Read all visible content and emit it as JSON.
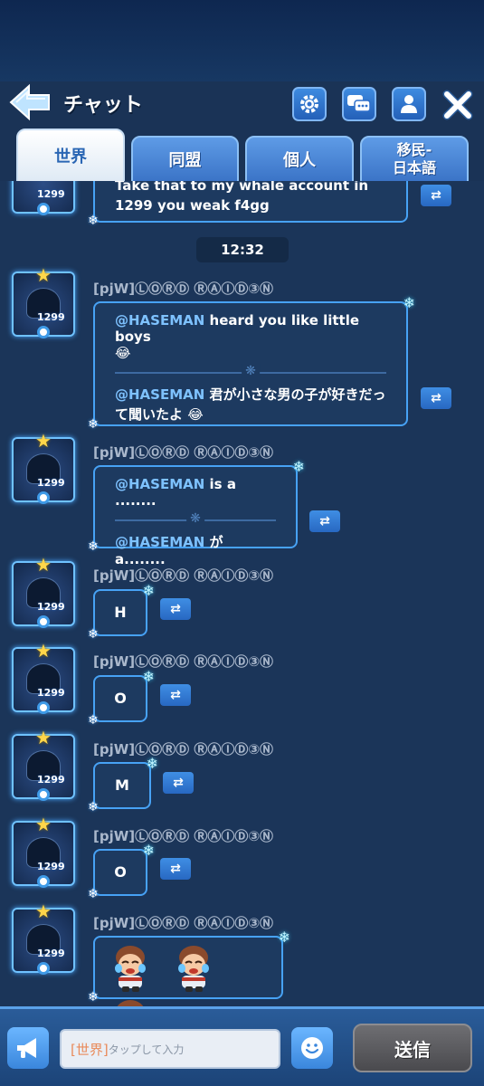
{
  "header": {
    "title": "チャット"
  },
  "tabs": [
    {
      "label": "世界",
      "active": true
    },
    {
      "label": "同盟",
      "active": false
    },
    {
      "label": "個人",
      "active": false
    },
    {
      "label": "移民-\n日本語",
      "active": false
    }
  ],
  "chat": {
    "time": "12:32",
    "partial_message": {
      "line1": "Take that to my whale account in",
      "line2": "1299 you weak f4gg"
    },
    "messages": [
      {
        "username": "[pjW]ⓁⓄⓇⒹ ⓇⒶⒾⒹ③Ⓝ",
        "avatar_level": "1299",
        "original_mention": "@HASEMAN",
        "original_text": " heard you like little boys",
        "original_emoji": "😂",
        "translated_mention": "@HASEMAN",
        "translated_text": " 君が小さな男の子が好きだって聞いたよ",
        "translated_emoji": "😂"
      },
      {
        "username": "[pjW]ⓁⓄⓇⒹ ⓇⒶⒾⒹ③Ⓝ",
        "avatar_level": "1299",
        "original_mention": "@HASEMAN",
        "original_text": " is a ........",
        "translated_mention": "@HASEMAN",
        "translated_text": " が a........"
      },
      {
        "username": "[pjW]ⓁⓄⓇⒹ ⓇⒶⒾⒹ③Ⓝ",
        "avatar_level": "1299",
        "text": "H"
      },
      {
        "username": "[pjW]ⓁⓄⓇⒹ ⓇⒶⒾⒹ③Ⓝ",
        "avatar_level": "1299",
        "text": "O"
      },
      {
        "username": "[pjW]ⓁⓄⓇⒹ ⓇⒶⒾⒹ③Ⓝ",
        "avatar_level": "1299",
        "text": "M"
      },
      {
        "username": "[pjW]ⓁⓄⓇⒹ ⓇⒶⒾⒹ③Ⓝ",
        "avatar_level": "1299",
        "text": "O"
      },
      {
        "username": "[pjW]ⓁⓄⓇⒹ ⓇⒶⒾⒹ③Ⓝ",
        "avatar_level": "1299"
      }
    ]
  },
  "input": {
    "channel": "[世界]",
    "placeholder": "タップして入力",
    "send_label": "送信"
  },
  "icons": {
    "back": "back-arrow-icon",
    "settings": "gear-icon",
    "chat_rooms": "chat-bubbles-icon",
    "profile": "person-icon",
    "close": "close-icon",
    "translate": "swap-arrows-icon",
    "megaphone": "megaphone-icon",
    "emoji": "smiley-icon"
  },
  "colors": {
    "background": "#1a3356",
    "bubble_border": "#47a2f5",
    "mention": "#7ec2ff",
    "send_button": "#5c5c60"
  }
}
